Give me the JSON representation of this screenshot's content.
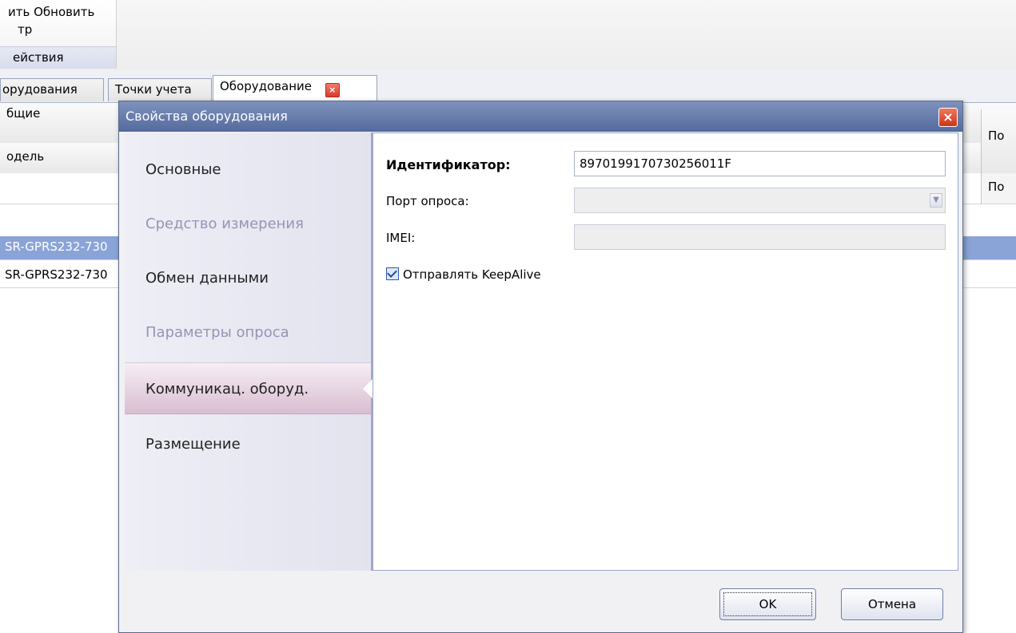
{
  "ribbon": {
    "line1": "ить  Обновить",
    "line2": "тр",
    "group_caption": "ействия"
  },
  "tabs": [
    {
      "label": "орудования"
    },
    {
      "label": "Точки учета"
    },
    {
      "label": "Оборудование"
    }
  ],
  "grid": {
    "header1": "бщие",
    "header2": "одель",
    "rows": [
      "SR-GPRS232-730",
      "SR-GPRS232-730"
    ],
    "right_header1": "По",
    "right_header2": "По"
  },
  "dialog": {
    "title": "Свойства оборудования",
    "close_label": "×",
    "nav_items": [
      {
        "label": "Основные",
        "state": "normal"
      },
      {
        "label": "Средство измерения",
        "state": "disabled"
      },
      {
        "label": "Обмен данными",
        "state": "normal"
      },
      {
        "label": "Параметры опроса",
        "state": "disabled"
      },
      {
        "label": "Коммуникац. оборуд.",
        "state": "selected"
      },
      {
        "label": "Размещение",
        "state": "normal"
      }
    ],
    "form": {
      "identifier_label": "Идентификатор:",
      "identifier_value": "8970199170730256011F",
      "port_label": "Порт опроса:",
      "port_value": "",
      "imei_label": "IMEI:",
      "imei_value": "",
      "keepalive_label": "Отправлять KeepAlive",
      "keepalive_checked": true
    },
    "buttons": {
      "ok": "OK",
      "cancel": "Отмена"
    }
  },
  "colors": {
    "titlebar": "#6a7fb0",
    "selected_nav": "#d9bed1",
    "selected_row": "#8aa4d8"
  }
}
